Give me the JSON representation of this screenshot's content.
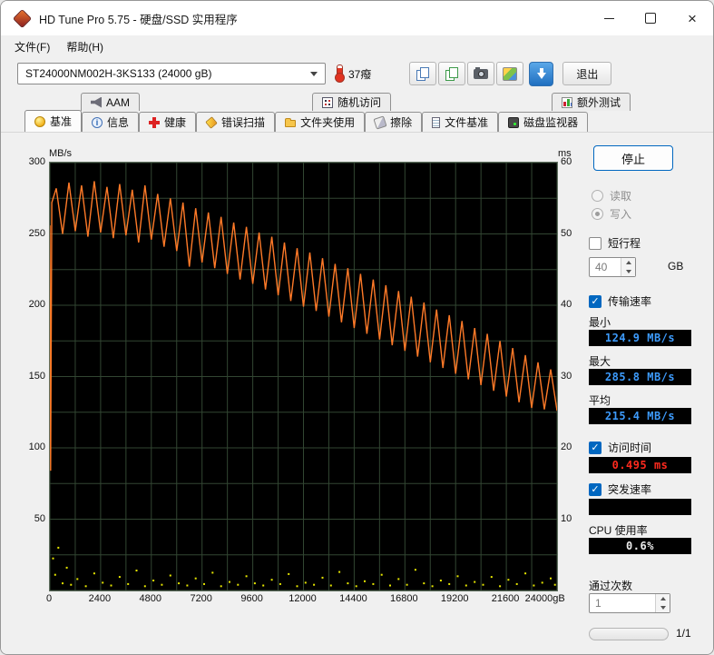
{
  "window": {
    "title": "HD Tune Pro 5.75 - 硬盘/SSD 实用程序"
  },
  "menu": {
    "file": "文件(F)",
    "help": "帮助(H)"
  },
  "toolbar": {
    "drive": "ST24000NM002H-3KS133  (24000 gB)",
    "temperature": "37癈",
    "exit_label": "退出"
  },
  "tabs": {
    "row1": [
      {
        "label": "AAM"
      },
      {
        "label": "随机访问"
      },
      {
        "label": "额外测试"
      }
    ],
    "row2": [
      {
        "label": "基准"
      },
      {
        "label": "信息"
      },
      {
        "label": "健康"
      },
      {
        "label": "错误扫描"
      },
      {
        "label": "文件夹使用"
      },
      {
        "label": "擦除"
      },
      {
        "label": "文件基准"
      },
      {
        "label": "磁盘监视器"
      }
    ]
  },
  "chart_data": {
    "type": "line",
    "title": "",
    "xlabel": "gB",
    "ylabel_left": "MB/s",
    "ylabel_right": "ms",
    "xlim": [
      0,
      24000
    ],
    "ylim_left": [
      0,
      300
    ],
    "ylim_right": [
      0,
      60
    ],
    "x_ticks": [
      0,
      2400,
      4800,
      7200,
      9600,
      12000,
      14400,
      16800,
      19200,
      21600
    ],
    "x_last_label": "24000gB",
    "y_left_ticks": [
      300,
      250,
      200,
      150,
      100,
      50
    ],
    "y_right_ticks": [
      60,
      50,
      40,
      30,
      20,
      10
    ],
    "x_grid_step": 1200,
    "y_grid_step": 25,
    "grid_color": "#324632",
    "plot_bg": "#000000",
    "stats": {
      "min_mbs": 124.9,
      "max_mbs": 285.8,
      "avg_mbs": 215.4,
      "access_ms": 0.495,
      "cpu_pct": 0.6
    },
    "series": [
      {
        "name": "transfer_rate_write",
        "kind": "line",
        "color": "#ff7a28",
        "points": [
          [
            0,
            256
          ],
          [
            35,
            84
          ],
          [
            90,
            272
          ],
          [
            300,
            282
          ],
          [
            600,
            250
          ],
          [
            900,
            286
          ],
          [
            1200,
            252
          ],
          [
            1500,
            284
          ],
          [
            1800,
            248
          ],
          [
            2100,
            287
          ],
          [
            2400,
            251
          ],
          [
            2700,
            283
          ],
          [
            3000,
            247
          ],
          [
            3300,
            285
          ],
          [
            3600,
            249
          ],
          [
            3900,
            281
          ],
          [
            4200,
            244
          ],
          [
            4500,
            284
          ],
          [
            4800,
            246
          ],
          [
            5100,
            278
          ],
          [
            5400,
            241
          ],
          [
            5700,
            275
          ],
          [
            6000,
            238
          ],
          [
            6300,
            272
          ],
          [
            6600,
            227
          ],
          [
            6900,
            268
          ],
          [
            7200,
            230
          ],
          [
            7500,
            265
          ],
          [
            7800,
            226
          ],
          [
            8100,
            262
          ],
          [
            8400,
            222
          ],
          [
            8700,
            258
          ],
          [
            9000,
            218
          ],
          [
            9300,
            255
          ],
          [
            9600,
            215
          ],
          [
            9900,
            251
          ],
          [
            10200,
            211
          ],
          [
            10500,
            248
          ],
          [
            10800,
            207
          ],
          [
            11100,
            244
          ],
          [
            11400,
            203
          ],
          [
            11700,
            240
          ],
          [
            12000,
            199
          ],
          [
            12300,
            237
          ],
          [
            12600,
            196
          ],
          [
            12900,
            233
          ],
          [
            13200,
            192
          ],
          [
            13500,
            229
          ],
          [
            13800,
            188
          ],
          [
            14100,
            226
          ],
          [
            14400,
            184
          ],
          [
            14700,
            222
          ],
          [
            15000,
            180
          ],
          [
            15300,
            218
          ],
          [
            15600,
            176
          ],
          [
            15900,
            214
          ],
          [
            16200,
            172
          ],
          [
            16500,
            210
          ],
          [
            16800,
            168
          ],
          [
            17100,
            206
          ],
          [
            17400,
            164
          ],
          [
            17700,
            202
          ],
          [
            18000,
            160
          ],
          [
            18300,
            197
          ],
          [
            18600,
            156
          ],
          [
            18900,
            193
          ],
          [
            19200,
            152
          ],
          [
            19500,
            189
          ],
          [
            19800,
            148
          ],
          [
            20100,
            184
          ],
          [
            20400,
            144
          ],
          [
            20700,
            180
          ],
          [
            21000,
            140
          ],
          [
            21300,
            175
          ],
          [
            21600,
            136
          ],
          [
            21900,
            170
          ],
          [
            22200,
            132
          ],
          [
            22500,
            165
          ],
          [
            22800,
            128
          ],
          [
            23100,
            160
          ],
          [
            23400,
            127
          ],
          [
            23700,
            155
          ],
          [
            24000,
            126
          ]
        ]
      },
      {
        "name": "access_time",
        "kind": "scatter",
        "color": "#e6e600",
        "points": [
          [
            150,
            4.5
          ],
          [
            250,
            2.2
          ],
          [
            400,
            6.0
          ],
          [
            600,
            1.0
          ],
          [
            800,
            3.2
          ],
          [
            1000,
            0.8
          ],
          [
            1300,
            1.6
          ],
          [
            1700,
            0.6
          ],
          [
            2100,
            2.4
          ],
          [
            2500,
            1.1
          ],
          [
            2900,
            0.7
          ],
          [
            3300,
            1.9
          ],
          [
            3700,
            0.9
          ],
          [
            4100,
            2.8
          ],
          [
            4500,
            0.6
          ],
          [
            4900,
            1.4
          ],
          [
            5300,
            0.8
          ],
          [
            5700,
            2.1
          ],
          [
            6100,
            1.0
          ],
          [
            6500,
            0.7
          ],
          [
            6900,
            1.7
          ],
          [
            7300,
            0.9
          ],
          [
            7700,
            2.5
          ],
          [
            8100,
            0.6
          ],
          [
            8500,
            1.2
          ],
          [
            8900,
            0.8
          ],
          [
            9300,
            2.0
          ],
          [
            9700,
            1.0
          ],
          [
            10100,
            0.7
          ],
          [
            10500,
            1.5
          ],
          [
            10900,
            0.9
          ],
          [
            11300,
            2.3
          ],
          [
            11700,
            0.6
          ],
          [
            12100,
            1.1
          ],
          [
            12500,
            0.8
          ],
          [
            12900,
            1.8
          ],
          [
            13300,
            0.7
          ],
          [
            13700,
            2.6
          ],
          [
            14100,
            1.0
          ],
          [
            14500,
            0.6
          ],
          [
            14900,
            1.3
          ],
          [
            15300,
            0.9
          ],
          [
            15700,
            2.2
          ],
          [
            16100,
            0.7
          ],
          [
            16500,
            1.6
          ],
          [
            16900,
            0.8
          ],
          [
            17300,
            2.9
          ],
          [
            17700,
            1.0
          ],
          [
            18100,
            0.6
          ],
          [
            18500,
            1.4
          ],
          [
            18900,
            0.9
          ],
          [
            19300,
            2.0
          ],
          [
            19700,
            0.7
          ],
          [
            20100,
            1.2
          ],
          [
            20500,
            0.8
          ],
          [
            20900,
            1.9
          ],
          [
            21300,
            0.6
          ],
          [
            21700,
            1.5
          ],
          [
            22100,
            0.9
          ],
          [
            22500,
            2.4
          ],
          [
            22900,
            0.7
          ],
          [
            23300,
            1.1
          ],
          [
            23700,
            1.7
          ],
          [
            23900,
            0.8
          ]
        ]
      }
    ]
  },
  "panel": {
    "stop_label": "停止",
    "read_label": "读取",
    "write_label": "写入",
    "short_stroke_label": "短行程",
    "short_stroke_value": "40",
    "gb_label": "GB",
    "transfer_label": "传输速率",
    "min_label": "最小",
    "min_value": "124.9 MB/s",
    "max_label": "最大",
    "max_value": "285.8 MB/s",
    "avg_label": "平均",
    "avg_value": "215.4 MB/s",
    "access_label": "访问时间",
    "access_value": "0.495 ms",
    "burst_label": "突发速率",
    "burst_value": "",
    "cpu_label": "CPU 使用率",
    "cpu_value": "0.6%",
    "pass_label": "通过次数",
    "pass_value": "1",
    "progress_label": "1/1"
  }
}
